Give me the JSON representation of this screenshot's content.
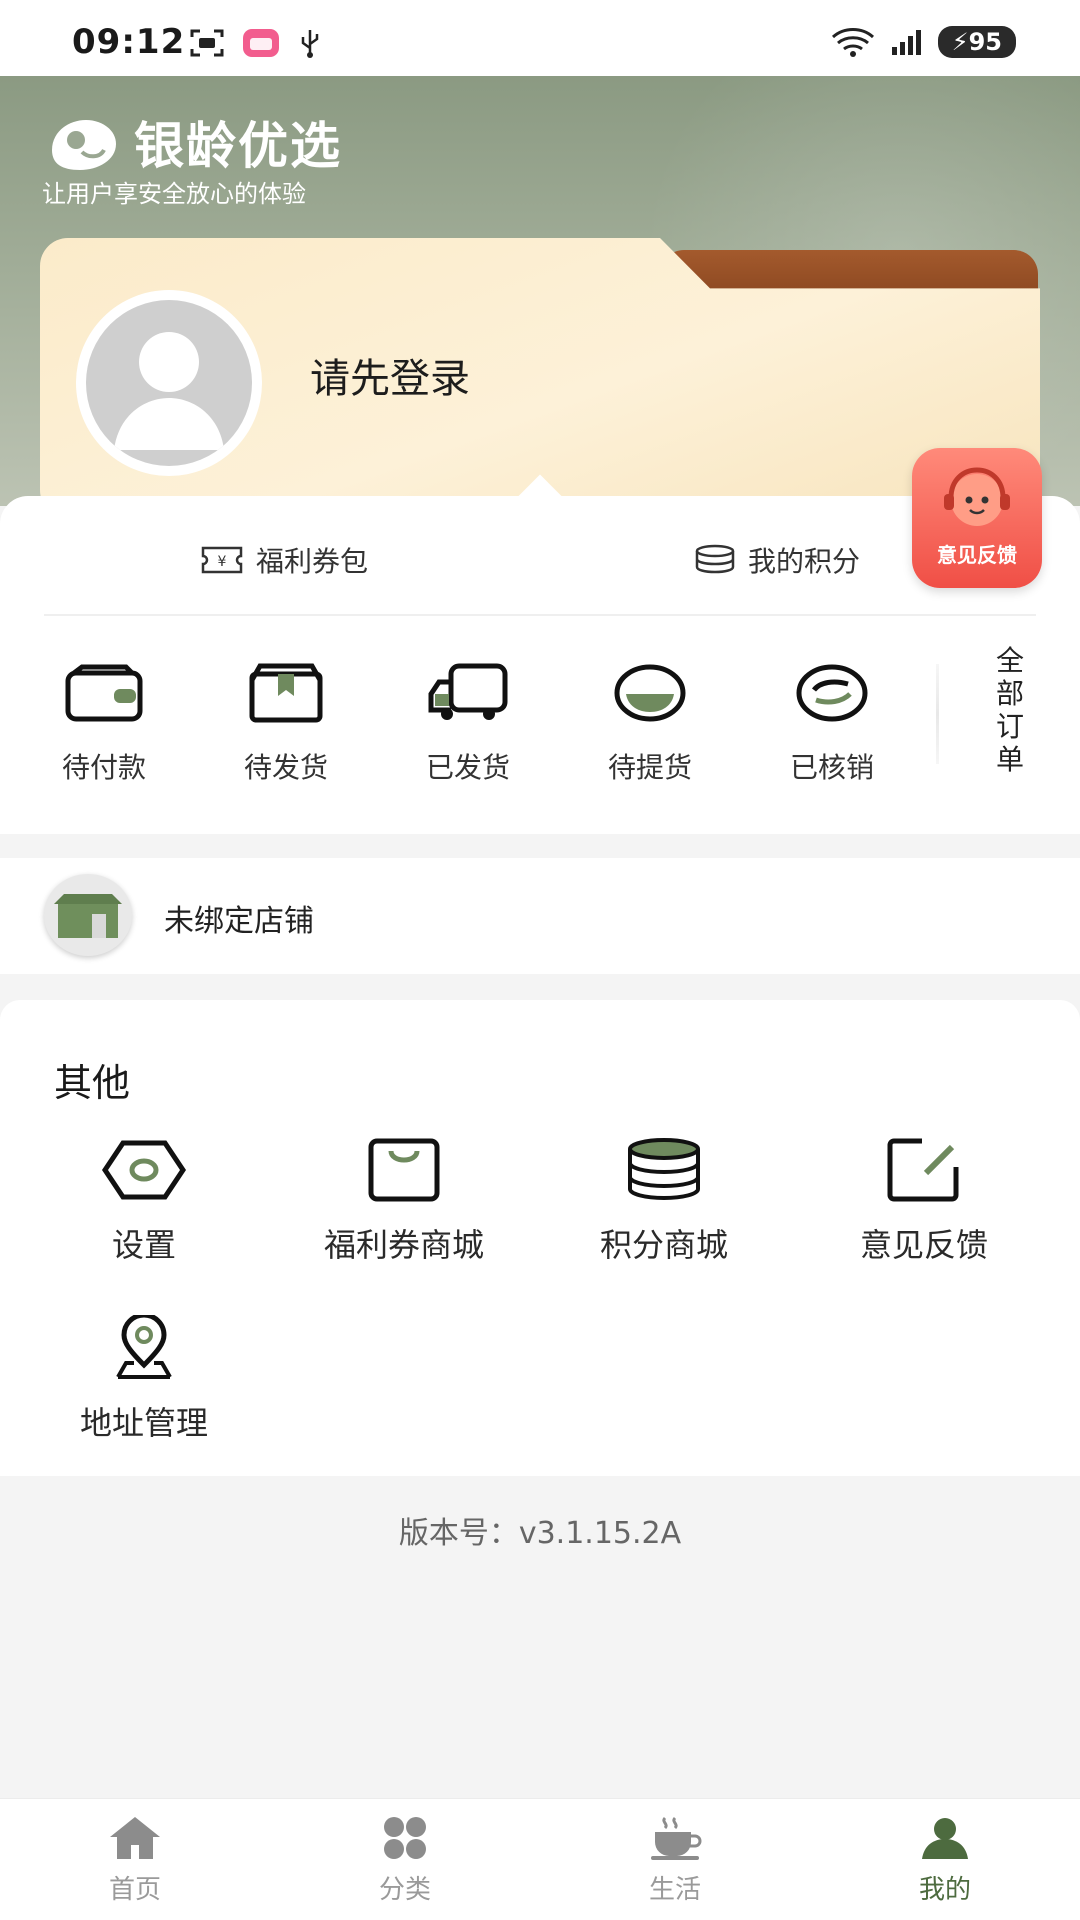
{
  "status_bar": {
    "time": "09:12",
    "battery": "95"
  },
  "header": {
    "app_title": "银龄优选",
    "tagline": "让用户享安全放心的体验"
  },
  "profile": {
    "login_prompt": "请先登录"
  },
  "quick_links": {
    "coupons": "福利券包",
    "points": "我的积分"
  },
  "feedback_fab": {
    "label": "意见反馈"
  },
  "orders": {
    "items": [
      {
        "label": "待付款",
        "icon": "wallet-icon"
      },
      {
        "label": "待发货",
        "icon": "box-icon"
      },
      {
        "label": "已发货",
        "icon": "truck-icon"
      },
      {
        "label": "待提货",
        "icon": "pickup-icon"
      },
      {
        "label": "已核销",
        "icon": "verified-icon"
      }
    ],
    "all_orders": [
      "全",
      "部",
      "订",
      "单"
    ]
  },
  "store": {
    "label": "未绑定店铺"
  },
  "others": {
    "title": "其他",
    "items": [
      {
        "label": "设置",
        "icon": "settings-icon"
      },
      {
        "label": "福利券商城",
        "icon": "shopping-bag-icon"
      },
      {
        "label": "积分商城",
        "icon": "coins-icon"
      },
      {
        "label": "意见反馈",
        "icon": "edit-icon"
      },
      {
        "label": "地址管理",
        "icon": "location-icon"
      }
    ]
  },
  "version": "版本号：v3.1.15.2A",
  "tabbar": {
    "items": [
      {
        "label": "首页",
        "icon": "home-icon"
      },
      {
        "label": "分类",
        "icon": "category-icon"
      },
      {
        "label": "生活",
        "icon": "coffee-icon"
      },
      {
        "label": "我的",
        "icon": "user-icon"
      }
    ],
    "active_index": 3
  },
  "colors": {
    "accent": "#4d6b3f",
    "hero": "#8b9a82",
    "fab": "#f04f46"
  }
}
